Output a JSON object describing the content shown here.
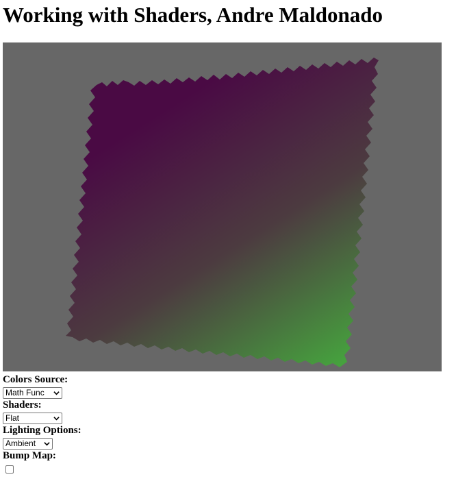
{
  "page": {
    "title": "Working with Shaders, Andre Maldonado"
  },
  "canvas": {
    "background_color": "#676767",
    "gradient_colors": [
      "#4a0a44",
      "#4c3b40",
      "#46a13e"
    ]
  },
  "controls": {
    "colors_source": {
      "label": "Colors Source:",
      "selected": "Math Func"
    },
    "shaders": {
      "label": "Shaders:",
      "selected": "Flat"
    },
    "lighting_options": {
      "label": "Lighting Options:",
      "selected": "Ambient"
    },
    "bump_map": {
      "label": "Bump Map:",
      "checked": false
    }
  }
}
